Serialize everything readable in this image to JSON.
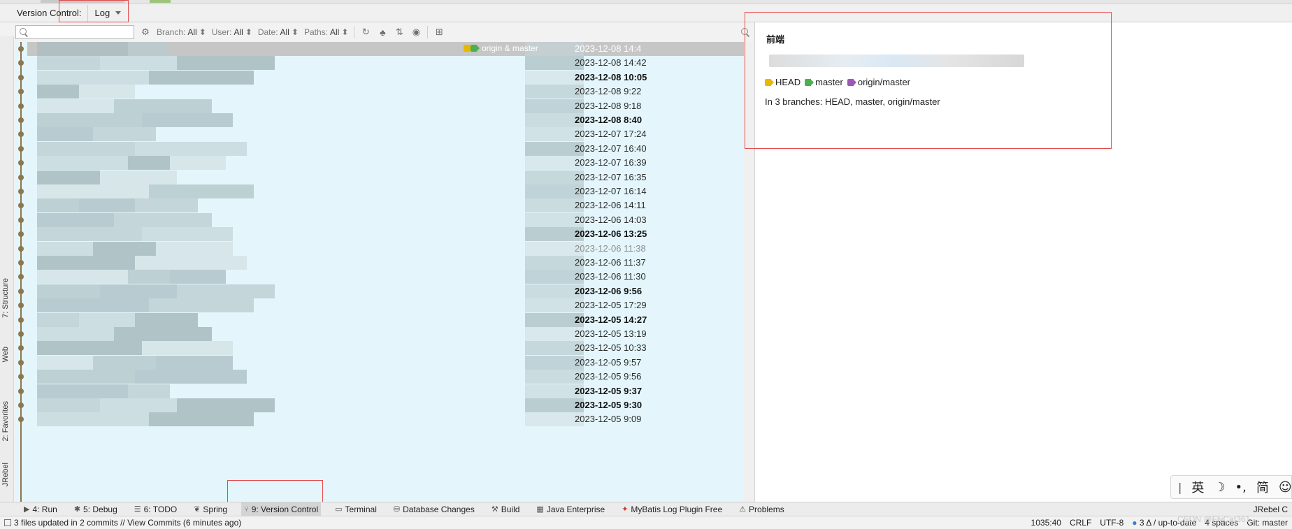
{
  "header": {
    "title": "Version Control:",
    "tab_label": "Log"
  },
  "toolbar": {
    "search_placeholder": "Q·",
    "filters": [
      {
        "name": "Branch:",
        "value": "All"
      },
      {
        "name": "User:",
        "value": "All"
      },
      {
        "name": "Date:",
        "value": "All"
      },
      {
        "name": "Paths:",
        "value": "All"
      }
    ]
  },
  "left_strip": [
    "7: Structure",
    "Web",
    "2: Favorites",
    "JRebel"
  ],
  "log": {
    "selected_refs": "origin & master",
    "rows": [
      {
        "date": "2023-12-08 14:4",
        "style": "selected"
      },
      {
        "date": "2023-12-08 14:42",
        "style": "normal"
      },
      {
        "date": "2023-12-08 10:05",
        "style": "bold"
      },
      {
        "date": "2023-12-08 9:22",
        "style": "normal"
      },
      {
        "date": "2023-12-08 9:18",
        "style": "normal"
      },
      {
        "date": "2023-12-08 8:40",
        "style": "bold"
      },
      {
        "date": "2023-12-07 17:24",
        "style": "normal"
      },
      {
        "date": "2023-12-07 16:40",
        "style": "normal"
      },
      {
        "date": "2023-12-07 16:39",
        "style": "normal"
      },
      {
        "date": "2023-12-07 16:35",
        "style": "normal"
      },
      {
        "date": "2023-12-07 16:14",
        "style": "normal"
      },
      {
        "date": "2023-12-06 14:11",
        "style": "normal"
      },
      {
        "date": "2023-12-06 14:03",
        "style": "normal"
      },
      {
        "date": "2023-12-06 13:25",
        "style": "bold"
      },
      {
        "date": "2023-12-06 11:38",
        "style": "dim"
      },
      {
        "date": "2023-12-06 11:37",
        "style": "normal"
      },
      {
        "date": "2023-12-06 11:30",
        "style": "normal"
      },
      {
        "date": "2023-12-06 9:56",
        "style": "bold"
      },
      {
        "date": "2023-12-05 17:29",
        "style": "normal"
      },
      {
        "date": "2023-12-05 14:27",
        "style": "bold"
      },
      {
        "date": "2023-12-05 13:19",
        "style": "normal"
      },
      {
        "date": "2023-12-05 10:33",
        "style": "normal"
      },
      {
        "date": "2023-12-05 9:57",
        "style": "normal"
      },
      {
        "date": "2023-12-05 9:56",
        "style": "normal"
      },
      {
        "date": "2023-12-05 9:37",
        "style": "bold"
      },
      {
        "date": "2023-12-05 9:30",
        "style": "bold"
      },
      {
        "date": "2023-12-05 9:09",
        "style": "normal"
      }
    ]
  },
  "detail": {
    "title": "前端",
    "refs": [
      {
        "label": "HEAD",
        "color": "#e6b800"
      },
      {
        "label": "master",
        "color": "#4caf50"
      },
      {
        "label": "origin/master",
        "color": "#9b59b6"
      }
    ],
    "branches_text": "In 3 branches: HEAD, master, origin/master"
  },
  "bottom_tabs": [
    {
      "icon": "▶",
      "label": "4: Run",
      "active": false
    },
    {
      "icon": "✱",
      "label": "5: Debug",
      "active": false
    },
    {
      "icon": "☰",
      "label": "6: TODO",
      "active": false
    },
    {
      "icon": "❦",
      "label": "Spring",
      "active": false
    },
    {
      "icon": "⑂",
      "label": "9: Version Control",
      "active": true
    },
    {
      "icon": "▭",
      "label": "Terminal",
      "active": false
    },
    {
      "icon": "⛁",
      "label": "Database Changes",
      "active": false
    },
    {
      "icon": "⚒",
      "label": "Build",
      "active": false
    },
    {
      "icon": "▦",
      "label": "Java Enterprise",
      "active": false
    },
    {
      "icon": "✦",
      "label": "MyBatis Log Plugin Free",
      "active": false
    },
    {
      "icon": "⚠",
      "label": "Problems",
      "active": false
    }
  ],
  "bottom_right_tab": "JRebel C",
  "status": {
    "message": "3 files updated in 2 commits // View Commits (6 minutes ago)",
    "position": "1035:40",
    "line_sep": "CRLF",
    "encoding": "UTF-8",
    "vcs_state": "3 Δ / up-to-date",
    "indent": "4 spaces",
    "branch": "Git: master"
  },
  "ime": [
    "英",
    "☽",
    "•,",
    "简",
    "☺"
  ],
  "watermark": "CSDN @FlyCat361"
}
